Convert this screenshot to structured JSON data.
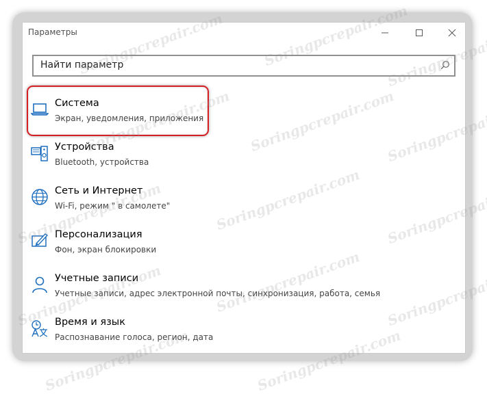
{
  "window": {
    "title": "Параметры",
    "controls": [
      "minimize-icon",
      "maximize-icon",
      "close-icon"
    ]
  },
  "search": {
    "placeholder": "Найти параметр",
    "icon": "search-icon"
  },
  "categories": [
    {
      "name": "Система",
      "desc": "Экран, уведомления, приложения",
      "icon": "laptop-icon",
      "highlighted": true
    },
    {
      "name": "Устройства",
      "desc": "Bluetooth, устройства",
      "icon": "devices-icon"
    },
    {
      "name": "Сеть и Интернет",
      "desc": "Wi-Fi, режим \" в самолете\"",
      "icon": "globe-icon"
    },
    {
      "name": "Персонализация",
      "desc": "Фон, экран блокировки",
      "icon": "personalization-icon"
    },
    {
      "name": "Учетные записи",
      "desc": "Учетные записи, адрес электронной почты, синхронизация, работа, семья",
      "icon": "user-icon"
    },
    {
      "name": "Время и язык",
      "desc": "Распознавание голоса, регион, дата",
      "icon": "time-language-icon"
    }
  ],
  "watermark": "Soringpcrepair.com",
  "colors": {
    "accent": "#1f6fbf",
    "highlight": "#d61f25"
  }
}
